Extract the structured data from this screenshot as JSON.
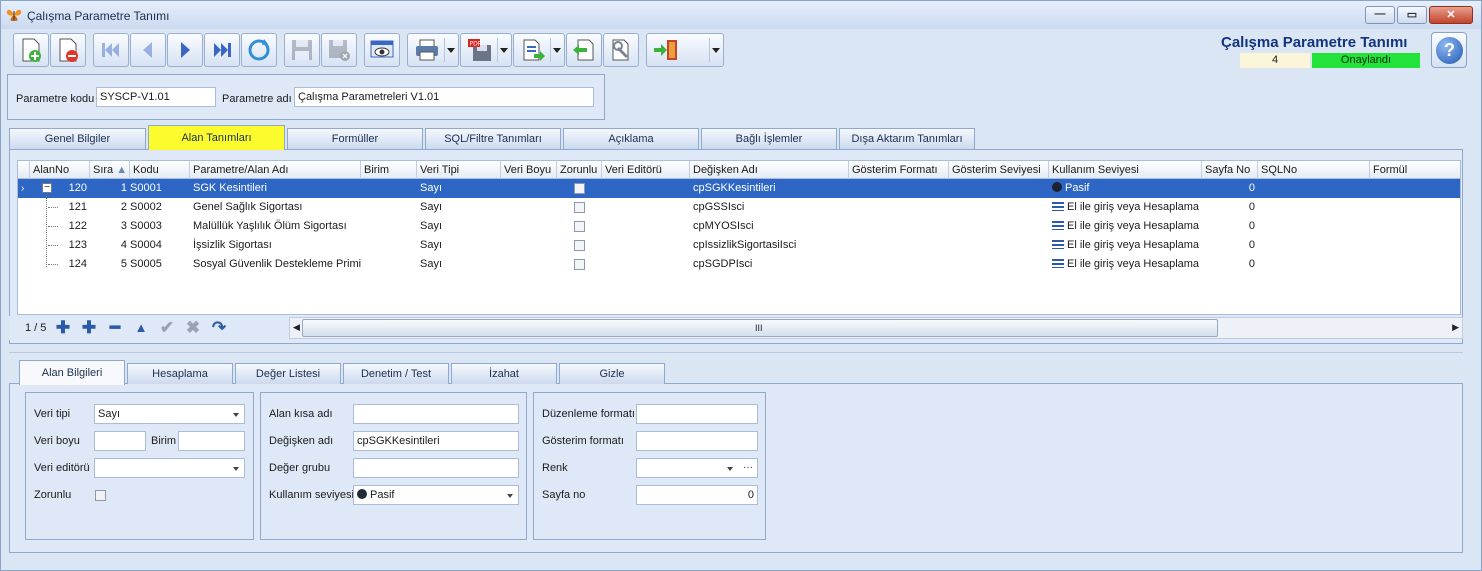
{
  "window": {
    "title": "Çalışma Parametre Tanımı"
  },
  "header": {
    "title": "Çalışma Parametre Tanımı",
    "number": "4",
    "status": "Onaylandı",
    "status_color": "#23e23a"
  },
  "toolbar_icons": [
    "new-document",
    "delete-document",
    "first",
    "previous",
    "next",
    "last",
    "refresh",
    "save",
    "save-close",
    "preview",
    "print",
    "pdf-export",
    "export",
    "import",
    "settings",
    "exit"
  ],
  "params": {
    "code_label": "Parametre kodu",
    "code_value": "SYSCP-V1.01",
    "name_label": "Parametre adı",
    "name_value": "Çalışma Parametreleri V1.01"
  },
  "tabs": [
    {
      "label": "Genel Bilgiler"
    },
    {
      "label": "Alan Tanımları",
      "active": true
    },
    {
      "label": "Formüller"
    },
    {
      "label": "SQL/Filtre Tanımları"
    },
    {
      "label": "Açıklama"
    },
    {
      "label": "Bağlı İşlemler"
    },
    {
      "label": "Dışa Aktarım Tanımları"
    }
  ],
  "grid": {
    "columns": [
      "AlanNo",
      "Sıra",
      "Kodu",
      "Parametre/Alan Adı",
      "Birim",
      "Veri Tipi",
      "Veri Boyu",
      "Zorunlu",
      "Veri Editörü",
      "Değişken Adı",
      "Gösterim Formatı",
      "Gösterim Seviyesi",
      "Kullanım Seviyesi",
      "Sayfa No",
      "SQLNo",
      "Formül"
    ],
    "rows": [
      {
        "alan_no": "120",
        "sira": "1",
        "kodu": "S0001",
        "ad": "SGK Kesintileri",
        "veri_tipi": "Sayı",
        "degisken": "cpSGKKesintileri",
        "kullanim": "Pasif",
        "kullanim_icon": "dot",
        "sayfa": "0",
        "selected": true
      },
      {
        "alan_no": "121",
        "sira": "2",
        "kodu": "S0002",
        "ad": "Genel Sağlık Sigortası",
        "veri_tipi": "Sayı",
        "degisken": "cpGSSIsci",
        "kullanim": "El ile giriş veya Hesaplama",
        "kullanim_icon": "lines",
        "sayfa": "0"
      },
      {
        "alan_no": "122",
        "sira": "3",
        "kodu": "S0003",
        "ad": "Malüllük Yaşlılık Ölüm Sigortası",
        "veri_tipi": "Sayı",
        "degisken": "cpMYOSIsci",
        "kullanim": "El ile giriş veya Hesaplama",
        "kullanim_icon": "lines",
        "sayfa": "0"
      },
      {
        "alan_no": "123",
        "sira": "4",
        "kodu": "S0004",
        "ad": "İşsizlik Sigortası",
        "veri_tipi": "Sayı",
        "degisken": "cpIssizlikSigortasiIsci",
        "kullanim": "El ile giriş veya Hesaplama",
        "kullanim_icon": "lines",
        "sayfa": "0"
      },
      {
        "alan_no": "124",
        "sira": "5",
        "kodu": "S0005",
        "ad": "Sosyal Güvenlik Destekleme Primi",
        "veri_tipi": "Sayı",
        "degisken": "cpSGDPIsci",
        "kullanim": "El ile giriş veya Hesaplama",
        "kullanim_icon": "lines",
        "sayfa": "0"
      }
    ],
    "record_count": "1 / 5",
    "scroll_grip": "III"
  },
  "bottom_tabs": [
    {
      "label": "Alan Bilgileri",
      "active": true
    },
    {
      "label": "Hesaplama"
    },
    {
      "label": "Değer Listesi"
    },
    {
      "label": "Denetim / Test"
    },
    {
      "label": "İzahat"
    },
    {
      "label": "Gizle"
    }
  ],
  "form": {
    "veri_tipi_label": "Veri tipi",
    "veri_tipi_value": "Sayı",
    "veri_boyu_label": "Veri boyu",
    "veri_boyu_value": "",
    "birim_label": "Birim",
    "birim_value": "",
    "veri_editoru_label": "Veri editörü",
    "veri_editoru_value": "",
    "zorunlu_label": "Zorunlu",
    "alan_kisa_adi_label": "Alan kısa adı",
    "alan_kisa_adi_value": "",
    "degisken_adi_label": "Değişken adı",
    "degisken_adi_value": "cpSGKKesintileri",
    "deger_grubu_label": "Değer grubu",
    "deger_grubu_value": "",
    "kullanim_seviyesi_label": "Kullanım seviyesi",
    "kullanim_seviyesi_value": "Pasif",
    "duzenleme_formati_label": "Düzenleme formatı",
    "duzenleme_formati_value": "",
    "gosterim_formati_label": "Gösterim formatı",
    "gosterim_formati_value": "",
    "renk_label": "Renk",
    "renk_value": "",
    "sayfa_no_label": "Sayfa no",
    "sayfa_no_value": "0"
  }
}
